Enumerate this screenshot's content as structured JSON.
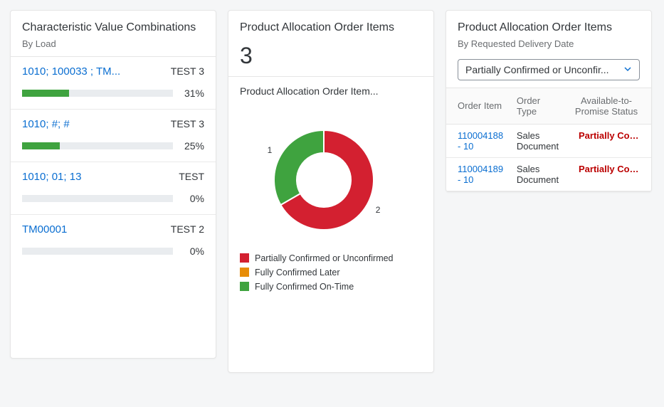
{
  "card1": {
    "title": "Characteristic Value Combinations",
    "subtitle": "By Load",
    "items": [
      {
        "label": "1010; 100033   ; TM...",
        "right": "TEST 3",
        "pct": 31
      },
      {
        "label": "1010; #; #",
        "right": "TEST 3",
        "pct": 25
      },
      {
        "label": "1010; 01; 13",
        "right": "TEST",
        "pct": 0
      },
      {
        "label": "TM00001",
        "right": "TEST 2",
        "pct": 0
      }
    ]
  },
  "card2": {
    "title": "Product Allocation Order Items",
    "count": "3",
    "chart_sub": "Product Allocation Order Item...",
    "legend": [
      {
        "label": "Partially Confirmed or Unconfirmed",
        "color": "#d32030"
      },
      {
        "label": "Fully Confirmed Later",
        "color": "#e78c07"
      },
      {
        "label": "Fully Confirmed On-Time",
        "color": "#3fa33f"
      }
    ]
  },
  "card3": {
    "title": "Product Allocation Order Items",
    "subtitle": "By Requested Delivery Date",
    "dropdown": "Partially Confirmed or Unconfir...",
    "columns": [
      "Order Item",
      "Order Type",
      "Available-to-Promise Status"
    ],
    "rows": [
      {
        "order_item": "110004188 - 10",
        "order_type": "Sales Document",
        "status": "Partially Confirme..."
      },
      {
        "order_item": "110004189 - 10",
        "order_type": "Sales Document",
        "status": "Partially Confirme..."
      }
    ]
  },
  "chart_data": {
    "type": "pie",
    "title": "Product Allocation Order Items",
    "series": [
      {
        "name": "Partially Confirmed or Unconfirmed",
        "value": 2,
        "color": "#d32030"
      },
      {
        "name": "Fully Confirmed Later",
        "value": 0,
        "color": "#e78c07"
      },
      {
        "name": "Fully Confirmed On-Time",
        "value": 1,
        "color": "#3fa33f"
      }
    ],
    "total": 3,
    "labels_shown": [
      "2",
      "1"
    ]
  }
}
